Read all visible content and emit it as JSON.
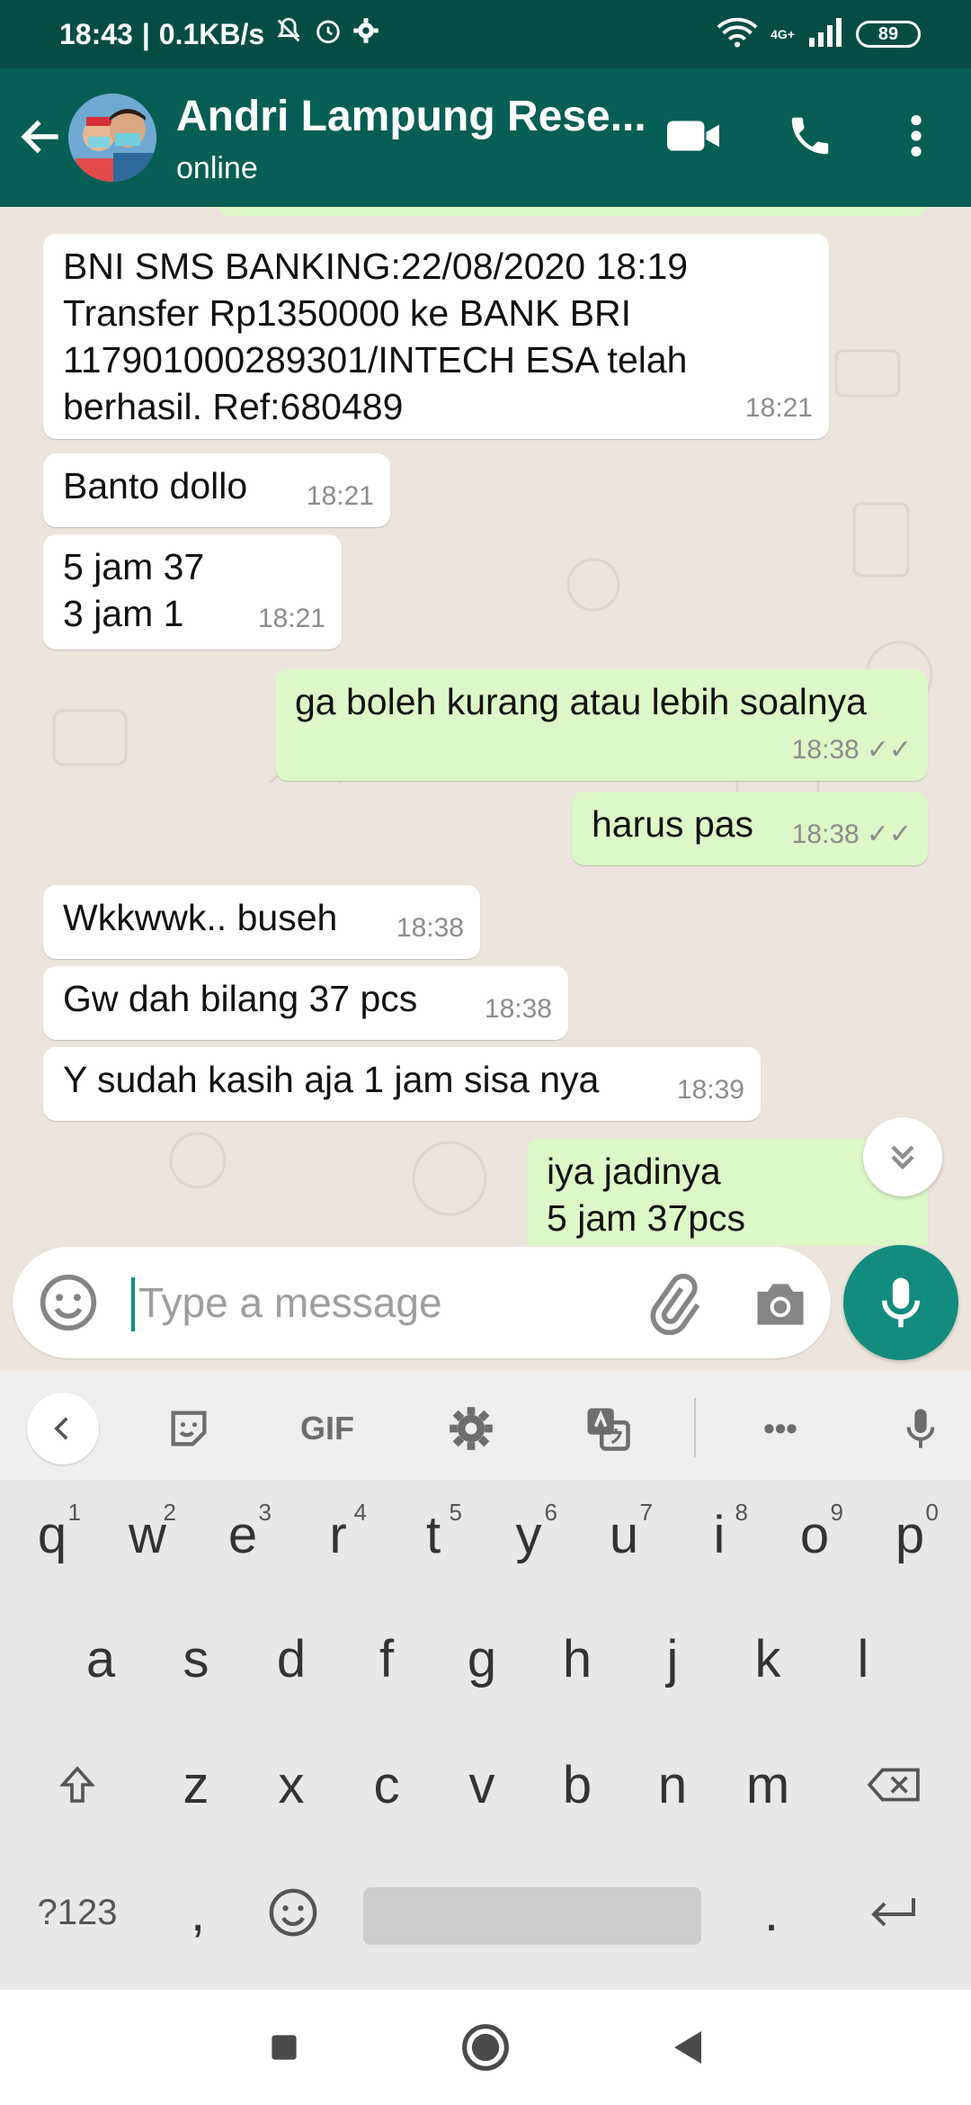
{
  "status_bar": {
    "time": "18:43",
    "speed": "0.1KB/s",
    "network": "4G+",
    "battery": "89"
  },
  "header": {
    "contact_name": "Andri Lampung Rese...",
    "contact_status": "online"
  },
  "messages": [
    {
      "dir": "in",
      "text": "BNI SMS BANKING:22/08/2020 18:19\nTransfer Rp1350000 ke BANK BRI\n117901000289301/INTECH ESA telah\nberhasil. Ref:680489",
      "time": "18:21"
    },
    {
      "dir": "in",
      "text": "Banto dollo",
      "time": "18:21"
    },
    {
      "dir": "in",
      "text": "5 jam 37\n3 jam 1",
      "time": "18:21"
    },
    {
      "dir": "out",
      "text": "ga boleh kurang atau lebih soalnya",
      "time": "18:38",
      "ticks": "✓✓"
    },
    {
      "dir": "out",
      "text": "harus pas",
      "time": "18:38",
      "ticks": "✓✓"
    },
    {
      "dir": "in",
      "text": "Wkkwwk.. buseh",
      "time": "18:38"
    },
    {
      "dir": "in",
      "text": "Gw dah bilang 37 pcs",
      "time": "18:38"
    },
    {
      "dir": "in",
      "text": "Y sudah kasih aja 1 jam sisa nya",
      "time": "18:39"
    },
    {
      "dir": "out",
      "text": "iya jadinya\n5 jam 37pcs",
      "time": "",
      "ticks": ""
    }
  ],
  "composer": {
    "placeholder": "Type a message"
  },
  "keyboard": {
    "toolbar": {
      "gif": "GIF",
      "more": "•••"
    },
    "row1": [
      {
        "k": "q",
        "n": "1"
      },
      {
        "k": "w",
        "n": "2"
      },
      {
        "k": "e",
        "n": "3"
      },
      {
        "k": "r",
        "n": "4"
      },
      {
        "k": "t",
        "n": "5"
      },
      {
        "k": "y",
        "n": "6"
      },
      {
        "k": "u",
        "n": "7"
      },
      {
        "k": "i",
        "n": "8"
      },
      {
        "k": "o",
        "n": "9"
      },
      {
        "k": "p",
        "n": "0"
      }
    ],
    "row2": [
      "a",
      "s",
      "d",
      "f",
      "g",
      "h",
      "j",
      "k",
      "l"
    ],
    "row3": [
      "z",
      "x",
      "c",
      "v",
      "b",
      "n",
      "m"
    ],
    "symbols": "?123",
    "comma": ",",
    "period": "."
  },
  "colors": {
    "header": "#075e54",
    "status_bar": "#054d44",
    "accent": "#128c7e",
    "outgoing_bubble": "#dcf8c6",
    "incoming_bubble": "#ffffff"
  }
}
